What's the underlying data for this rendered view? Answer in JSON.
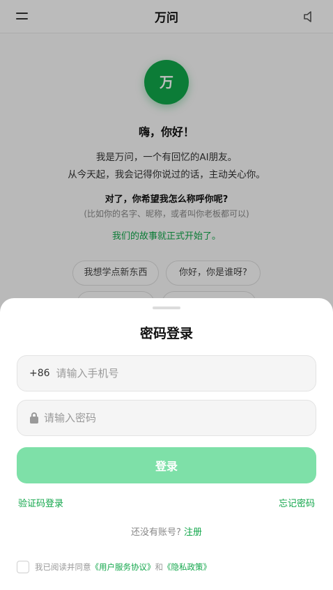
{
  "header": {
    "title": "万问",
    "menu_icon": "hamburger-menu-icon",
    "sound_icon": "speaker-icon"
  },
  "intro": {
    "logo_text": "万",
    "greeting": "嗨，你好！",
    "line1": "我是万问，一个有回忆的AI朋友。",
    "line2": "从今天起，我会记得你说过的话，主动关心你。",
    "question": "对了，你希望我怎么称呼你呢?",
    "hint": "(比如你的名字、昵称，或者叫你老板都可以)",
    "start": "我们的故事就正式开始了。",
    "chips": [
      "我想学点新东西",
      "你好，你是谁呀?",
      "",
      ""
    ]
  },
  "login": {
    "title": "密码登录",
    "country_code": "+86",
    "phone_placeholder": "请输入手机号",
    "password_placeholder": "请输入密码",
    "login_button": "登录",
    "sms_login": "验证码登录",
    "forgot_password": "忘记密码",
    "no_account": "还没有账号?",
    "register": "注册",
    "agree_prefix": "我已阅读并同意",
    "terms": "《用户服务协议》",
    "and": "和",
    "privacy": "《隐私政策》"
  },
  "colors": {
    "accent": "#11a64a",
    "button_disabled": "#7ee0a8"
  }
}
